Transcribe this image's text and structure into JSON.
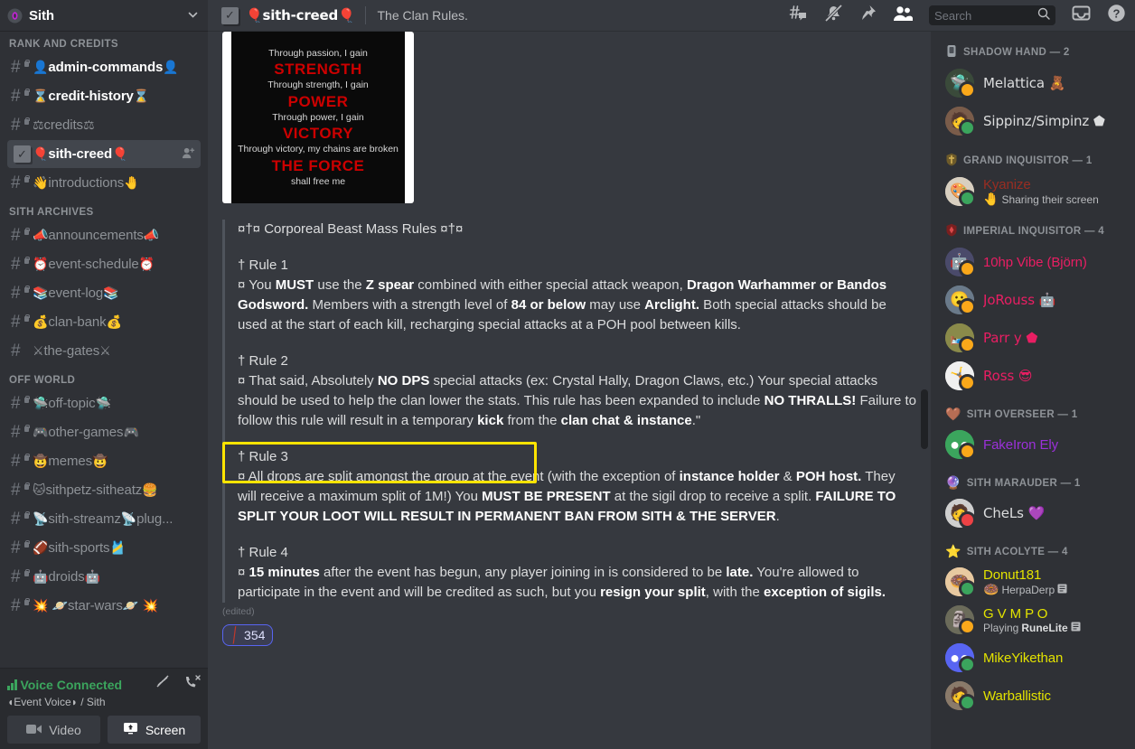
{
  "server": {
    "name": "Sith",
    "badge_icon": "sith-emblem-icon",
    "chevron_icon": "chevron-down-icon"
  },
  "sidebar": {
    "categories": [
      {
        "label": "RANK AND CREDITS",
        "channels": [
          {
            "emoji_left": "👤",
            "name": "admin-commands",
            "emoji_right": "👤",
            "state": "unread",
            "locked": true,
            "icon": "hash-lock-icon"
          },
          {
            "emoji_left": "⌛",
            "name": "credit-history",
            "emoji_right": "⌛",
            "state": "unread",
            "locked": true,
            "icon": "hash-lock-icon"
          },
          {
            "emoji_left": "⚖",
            "name": "credits",
            "emoji_right": "⚖",
            "state": "muted",
            "locked": true,
            "icon": "hash-lock-icon"
          },
          {
            "emoji_left": "🎈",
            "name": "sith-creed",
            "emoji_right": "🎈",
            "state": "active",
            "locked": false,
            "icon": "checkbox-icon",
            "trailing_icon": "add-member-icon"
          },
          {
            "emoji_left": "👋",
            "name": "introductions",
            "emoji_right": "🤚",
            "state": "muted",
            "locked": true,
            "icon": "hash-lock-icon"
          }
        ]
      },
      {
        "label": "SITH ARCHIVES",
        "channels": [
          {
            "emoji_left": "📣",
            "name": "announcements",
            "emoji_right": "📣",
            "state": "muted",
            "locked": true,
            "icon": "hash-lock-icon"
          },
          {
            "emoji_left": "⏰",
            "name": "event-schedule",
            "emoji_right": "⏰",
            "state": "muted",
            "locked": true,
            "icon": "hash-lock-icon"
          },
          {
            "emoji_left": "📚",
            "name": "event-log",
            "emoji_right": "📚",
            "state": "muted",
            "locked": true,
            "icon": "hash-lock-icon"
          },
          {
            "emoji_left": "💰",
            "name": "clan-bank",
            "emoji_right": "💰",
            "state": "muted",
            "locked": true,
            "icon": "hash-lock-icon"
          },
          {
            "emoji_left": "⚔",
            "name": "the-gates",
            "emoji_right": "⚔",
            "state": "muted",
            "locked": false,
            "icon": "hash-icon"
          }
        ]
      },
      {
        "label": "OFF WORLD",
        "channels": [
          {
            "emoji_left": "🛸",
            "name": "off-topic",
            "emoji_right": "🛸",
            "state": "muted",
            "locked": true,
            "icon": "hash-lock-icon"
          },
          {
            "emoji_left": "🎮",
            "name": "other-games",
            "emoji_right": "🎮",
            "state": "muted",
            "locked": true,
            "icon": "hash-lock-icon"
          },
          {
            "emoji_left": "🤠",
            "name": "memes",
            "emoji_right": "🤠",
            "state": "muted",
            "locked": true,
            "icon": "hash-lock-icon"
          },
          {
            "emoji_left": "🐱",
            "name": "sithpetz-sitheatz",
            "emoji_right": "🍔",
            "state": "muted",
            "locked": true,
            "icon": "hash-lock-icon"
          },
          {
            "emoji_left": "📡",
            "name": "sith-streamz",
            "emoji_right": "📡",
            "state": "muted",
            "locked": true,
            "icon": "hash-lock-icon",
            "suffix": "plug..."
          },
          {
            "emoji_left": "🏈",
            "name": "sith-sports",
            "emoji_right": "🎽",
            "state": "muted",
            "locked": true,
            "icon": "hash-lock-icon"
          },
          {
            "emoji_left": "🤖",
            "name": "droids",
            "emoji_right": "🤖",
            "state": "muted",
            "locked": true,
            "icon": "hash-lock-icon"
          },
          {
            "emoji_left": "💥 🪐",
            "name": "star-wars",
            "emoji_right": "🪐 💥",
            "state": "muted",
            "locked": true,
            "icon": "hash-lock-icon"
          }
        ]
      }
    ]
  },
  "voice": {
    "status": "Voice Connected",
    "channel_line": "◖Event Voice◗ / Sith",
    "signal_icon": "signal-bars-icon",
    "noise_suppression_icon": "noise-suppression-off-icon",
    "disconnect_icon": "disconnect-call-icon",
    "video_label": "Video",
    "video_icon": "camera-icon",
    "screen_label": "Screen",
    "screen_icon": "screen-share-icon"
  },
  "topbar": {
    "channel_icon": "checkbox-icon",
    "channel_name": "🎈sith-creed🎈",
    "topic": "The Clan Rules.",
    "icons": [
      {
        "name": "threads-icon"
      },
      {
        "name": "bell-off-icon"
      },
      {
        "name": "pinned-messages-icon"
      },
      {
        "name": "members-icon"
      }
    ],
    "inbox_icon": "inbox-icon",
    "help_icon": "help-icon"
  },
  "search": {
    "placeholder": "Search",
    "value": "",
    "icon": "search-icon"
  },
  "message": {
    "image": {
      "alt": "sith-code-image",
      "lines": [
        {
          "text": "Through passion, I gain",
          "style": "small"
        },
        {
          "text": "STRENGTH",
          "style": "big"
        },
        {
          "text": "Through strength, I gain",
          "style": "small"
        },
        {
          "text": "POWER",
          "style": "big"
        },
        {
          "text": "Through power, I gain",
          "style": "small"
        },
        {
          "text": "VICTORY",
          "style": "big"
        },
        {
          "text": "Through victory, my chains are broken",
          "style": "small"
        },
        {
          "text": "THE FORCE",
          "style": "big"
        },
        {
          "text": "shall free me",
          "style": "small"
        }
      ]
    },
    "title": "¤†¤ Corporeal Beast Mass Rules ¤†¤",
    "rules": [
      {
        "heading": "† Rule 1",
        "body_html": "¤ You <b>MUST</b> use the <b>Z spear</b> combined with either special attack weapon, <b>Dragon Warhammer or Bandos Godsword.</b> Members with a strength level of <b>84 or below</b> may use <b>Arclight.</b> Both special attacks should be used at the start of each kill, recharging special attacks at a POH pool between kills."
      },
      {
        "heading": "† Rule 2",
        "body_html": "¤ That said, Absolutely <b>NO DPS</b> special attacks (ex: Crystal Hally, Dragon Claws, etc.) Your special attacks should be used to help the clan lower the stats. This rule has been expanded to include <b>NO THRALLS!</b> Failure to follow this rule will result in a temporary <b>kick</b> from the <b>clan chat &amp; instance</b>.\""
      },
      {
        "heading": "† Rule 3",
        "body_html": "¤ All drops are split amongst the group at the event (with the exception of <b>instance holder</b> &amp; <b>POH host.</b> They will receive a maximum split of 1M!) You <b>MUST BE PRESENT</b> at the sigil drop to receive a split. <b>FAILURE TO SPLIT YOUR LOOT WILL RESULT IN PERMANENT BAN FROM SITH &amp; THE SERVER</b>.",
        "highlighted": true
      },
      {
        "heading": "† Rule 4",
        "body_html": "¤ <b>15 minutes</b> after the event has begun, any player joining in is considered to be <b>late.</b> You're allowed to participate in the event and will be credited as such, but you <b>resign your split</b>, with the <b>exception of sigils.</b>"
      }
    ],
    "edited_label": "(edited)",
    "reaction": {
      "emoji": "╱",
      "emoji_name": "slash-emoji",
      "count": "354"
    }
  },
  "highlight_color": "#ffe400",
  "members": {
    "groups": [
      {
        "role_icon": "shadow-hand-badge-icon",
        "label": "SHADOW HAND — 2",
        "color": "#dcddde",
        "people": [
          {
            "name": "Melattica 🧸",
            "color": "#dcddde",
            "status": "idle",
            "avatar_emoji": "🪐",
            "avatar_bg": "#3a4a3a",
            "activity": ""
          },
          {
            "name": "Sippinz/Simpinz ⬟",
            "color": "#dcddde",
            "status": "online",
            "avatar_emoji": "👤",
            "avatar_bg": "#7a5c4a",
            "activity": ""
          }
        ]
      },
      {
        "role_icon": "grand-inquisitor-badge-icon",
        "label": "GRAND INQUISITOR — 1",
        "color": "#dcddde",
        "people": [
          {
            "name": "Kyanize",
            "color": "#992d22",
            "status": "online",
            "avatar_emoji": "🎨",
            "avatar_bg": "#d8cfc0",
            "activity": "Sharing their screen",
            "activity_icon": "🤚"
          }
        ]
      },
      {
        "role_icon": "imperial-inquisitor-badge-icon",
        "label": "IMPERIAL INQUISITOR — 4",
        "color": "#dcddde",
        "people": [
          {
            "name": "10hp Vibe (Björn)",
            "color": "#e91e63",
            "status": "idle",
            "avatar_emoji": "🤖",
            "avatar_bg": "#4a4a6a",
            "activity": ""
          },
          {
            "name": "JoRouss 🤖",
            "color": "#e91e63",
            "status": "idle",
            "avatar_emoji": "😮",
            "avatar_bg": "#6a7a8a",
            "activity": ""
          },
          {
            "name": "Parr y ⬟",
            "color": "#e91e63",
            "status": "idle",
            "avatar_emoji": "🛏",
            "avatar_bg": "#8a8a4a",
            "activity": ""
          },
          {
            "name": "Ross 😎",
            "color": "#e91e63",
            "status": "idle",
            "avatar_emoji": "🤸",
            "avatar_bg": "#f0f0f0",
            "activity": ""
          }
        ]
      },
      {
        "role_icon": "sith-overseer-badge-icon",
        "label": "SITH OVERSEER — 1",
        "color": "#dcddde",
        "people": [
          {
            "name": "FakeIron Ely",
            "color": "#9b30d9",
            "status": "idle",
            "avatar_emoji": "🎮",
            "avatar_bg": "#3ba55d",
            "activity": ""
          }
        ]
      },
      {
        "role_icon": "sith-marauder-badge-icon",
        "label": "SITH MARAUDER — 1",
        "color": "#dcddde",
        "people": [
          {
            "name": "CheLs 💜",
            "color": "#dcddde",
            "status": "dnd",
            "avatar_emoji": "👤",
            "avatar_bg": "#cfcfcf",
            "activity": ""
          }
        ]
      },
      {
        "role_icon": "sith-acolyte-badge-icon",
        "label": "SITH ACOLYTE — 4",
        "color": "#dcddde",
        "people": [
          {
            "name": "Donut181",
            "color": "#e3e300",
            "status": "online",
            "avatar_emoji": "🍩",
            "avatar_bg": "#e8c9a0",
            "activity": "HerpaDerp",
            "activity_icon": "🍩",
            "activity_badge": "game-icon"
          },
          {
            "name": "G V M P O",
            "color": "#e3e300",
            "status": "idle",
            "avatar_emoji": "🗿",
            "avatar_bg": "#6b6b5a",
            "activity_prefix": "Playing",
            "activity_bold": "RuneLite",
            "activity_badge": "game-icon"
          },
          {
            "name": "MikeYikethan",
            "color": "#e3e300",
            "status": "online",
            "avatar_emoji": "🎮",
            "avatar_bg": "#5865f2",
            "activity": ""
          },
          {
            "name": "Warballistic",
            "color": "#e3e300",
            "status": "online",
            "avatar_emoji": "👤",
            "avatar_bg": "#8a7a6a",
            "activity": ""
          }
        ]
      }
    ]
  }
}
